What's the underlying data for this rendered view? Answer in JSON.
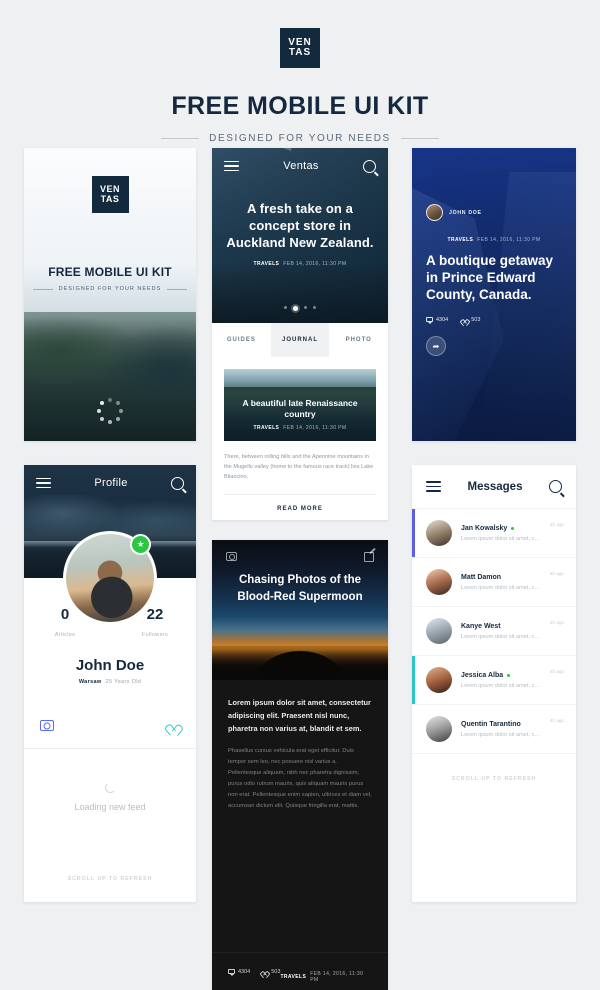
{
  "header": {
    "logo_line1": "VEN",
    "logo_line2": "TAS",
    "title": "FREE MOBILE UI KIT",
    "subtitle": "DESIGNED FOR YOUR NEEDS"
  },
  "splash": {
    "logo_line1": "VEN",
    "logo_line2": "TAS",
    "title": "FREE MOBILE UI KIT",
    "subtitle": "DESIGNED FOR YOUR NEEDS",
    "loader_icon": "loading-dots-spinner"
  },
  "feed": {
    "nav": {
      "menu_icon": "hamburger-icon",
      "title": "Ventas",
      "search_icon": "search-icon"
    },
    "hero": {
      "headline": "A fresh take on a concept store in Auckland New Zealand.",
      "category": "TRAVELS",
      "date": "FEB 14, 2016, 11:30 PM",
      "dots_total": 4,
      "dot_active_index": 1
    },
    "tabs": [
      {
        "label": "GUIDES",
        "active": false
      },
      {
        "label": "JOURNAL",
        "active": true
      },
      {
        "label": "PHOTO",
        "active": false
      }
    ],
    "article": {
      "title": "A beautiful late Renaissance country",
      "category": "TRAVELS",
      "date": "FEB 14, 2016, 11:30 PM",
      "body": "There, between rolling hills and the Apennine mountains in the Mugello valley (home to the famous race track) lies Lake Bilancino.",
      "read_more": "READ MORE"
    }
  },
  "post": {
    "author": "JOHN DOE",
    "avatar_icon": "user-avatar",
    "category": "TRAVELS",
    "date": "FEB 14, 2016, 11:30 PM",
    "headline": "A boutique getaway in Prince Edward County, Canada.",
    "comments": "4304",
    "likes": "503",
    "comment_icon": "comment-icon",
    "like_icon": "heart-icon",
    "share_icon": "share-icon",
    "share_glyph": "➦"
  },
  "profile": {
    "nav": {
      "menu_icon": "hamburger-icon",
      "title": "Profile",
      "search_icon": "search-icon"
    },
    "badge_icon": "star-badge-icon",
    "badge_glyph": "★",
    "stats": [
      {
        "value": "0",
        "label": "Articles"
      },
      {
        "value": "22",
        "label": "Followers"
      }
    ],
    "name": "John Doe",
    "city": "Warsaw",
    "age": "25 Years Old",
    "camera_icon": "camera-icon",
    "heart_icon": "heart-icon",
    "loading_icon": "refresh-spinner-icon",
    "loading_text": "Loading new feed",
    "scroll_hint": "SCROLL UP TO REFRESH"
  },
  "moon": {
    "camera_icon": "camera-icon",
    "edit_icon": "edit-icon",
    "title": "Chasing Photos of the Blood-Red Supermoon",
    "lead": "Lorem ipsum dolor sit amet, consectetur adipiscing elit. Praesent nisl nunc, pharetra non varius at, blandit et sem.",
    "body": "Phasellus cursus vehicula erat eget efficitur. Duis tempor sem leo, nec posuere nisl varius a.  Pellentesque aliquam, nibh nec pharetra dignissim, purus odio rutrum mauris, quis aliquam mauris purus non erat. Pellentesque enim sapien, ultrices et diam vel, accumsan dictum elit. Quisque fringilla erat, mattis.",
    "comments": "4304",
    "likes": "503",
    "category": "TRAVELS",
    "date": "FEB 14, 2016, 11:30 PM"
  },
  "messages": {
    "nav": {
      "menu_icon": "hamburger-icon",
      "title": "Messages",
      "search_icon": "search-icon"
    },
    "preview": "Lorem ipsum dolor sit amet, consectetur.",
    "time": "4h ago",
    "items": [
      {
        "name": "Jan Kowalsky",
        "online": true,
        "accent": "a1"
      },
      {
        "name": "Matt Damon",
        "online": false,
        "accent": ""
      },
      {
        "name": "Kanye West",
        "online": false,
        "accent": ""
      },
      {
        "name": "Jessica Alba",
        "online": true,
        "accent": "a2"
      },
      {
        "name": "Quentin Tarantino",
        "online": false,
        "accent": ""
      }
    ],
    "scroll_hint": "SCROLL UP TO REFRESH"
  },
  "colors": {
    "page_bg": "#eff0f2",
    "navy": "#14293f",
    "green": "#26c93f",
    "purple": "#5b5fe0",
    "cyan": "#2bc6c9"
  }
}
